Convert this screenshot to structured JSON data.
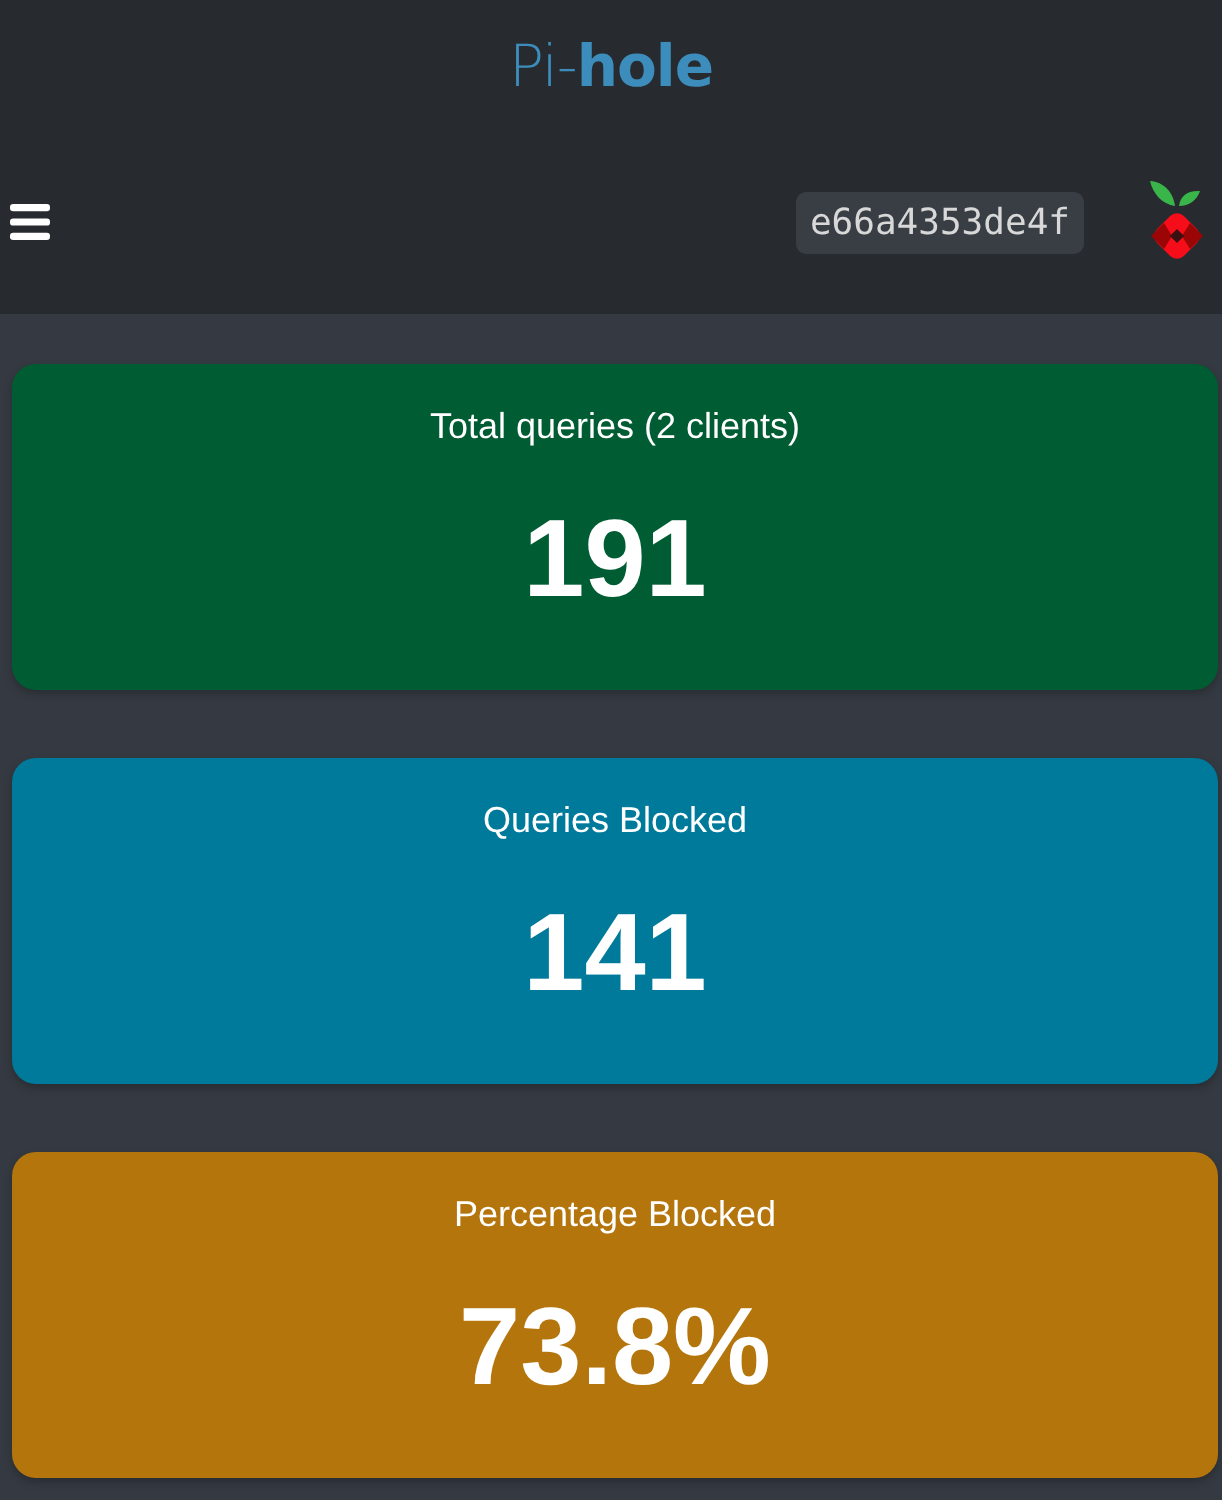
{
  "header": {
    "brand": "Pi-**hole**",
    "hostname": "e66a4353de4f"
  },
  "stats": [
    {
      "label": "Total queries (2 clients)",
      "value": "191",
      "color": "#005c32"
    },
    {
      "label": "Queries Blocked",
      "value": "141",
      "color": "#007a9b"
    },
    {
      "label": "Percentage Blocked",
      "value": "73.8%",
      "color": "#b4750c"
    }
  ]
}
